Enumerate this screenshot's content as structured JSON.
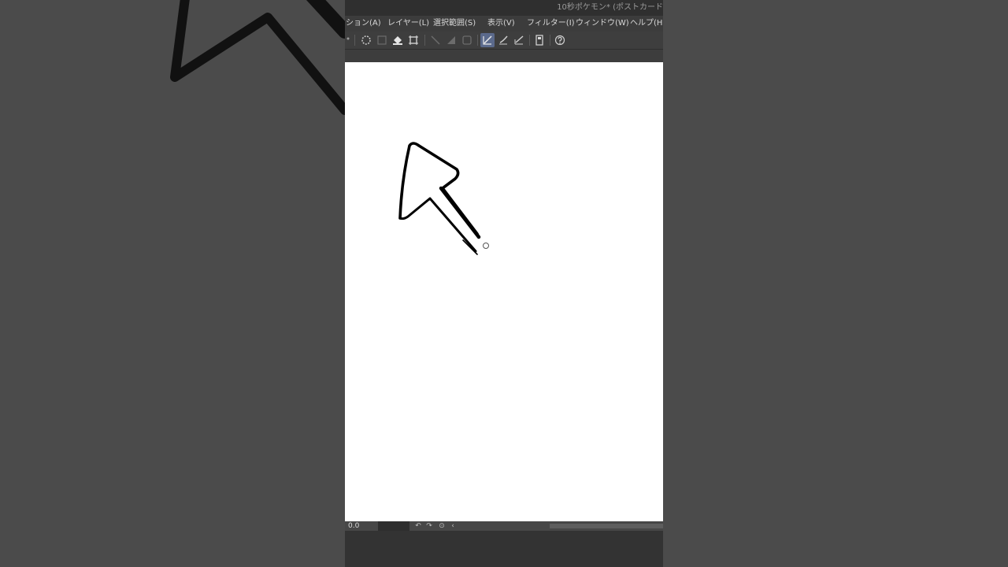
{
  "window": {
    "title": "10秒ポケモン* (ポストカード"
  },
  "menu": {
    "items": [
      {
        "label": "ション(A)"
      },
      {
        "label": "レイヤー(L)"
      },
      {
        "label": "選択範囲(S)"
      },
      {
        "label": "表示(V)"
      },
      {
        "label": "フィルター(I)"
      },
      {
        "label": "ウィンドウ(W)"
      },
      {
        "label": "ヘルプ(H)"
      }
    ]
  },
  "toolbar": {
    "icons": [
      "select-all-icon",
      "clear-selection-icon",
      "fill-icon",
      "transform-icon",
      "snap-ruler-icon",
      "snap-grid-icon",
      "snap-special-icon",
      "pen-icon",
      "brush-icon",
      "eraser-icon",
      "device-icon",
      "help-icon"
    ],
    "active_icon": "pen-icon"
  },
  "status": {
    "zoom": "0.0"
  },
  "colors": {
    "accent_active": "#5b6a8c",
    "canvas": "#ffffff",
    "ink": "#000000"
  }
}
